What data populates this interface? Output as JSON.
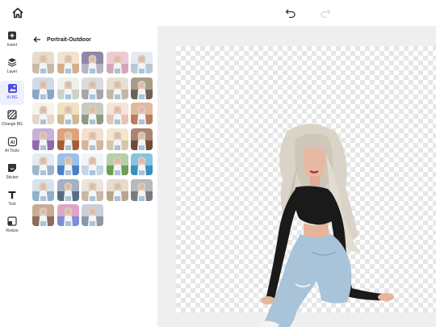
{
  "topbar": {
    "home_icon": "home-icon",
    "undo_icon": "undo-icon",
    "redo_icon": "redo-icon"
  },
  "toolbar": {
    "items": [
      {
        "label": "Insert",
        "icon": "insert-icon"
      },
      {
        "label": "Layer",
        "icon": "layers-icon"
      },
      {
        "label": "AI BG",
        "icon": "ai-bg-icon",
        "active": true
      },
      {
        "label": "Change BG",
        "icon": "change-bg-icon"
      },
      {
        "label": "AI Tools",
        "icon": "ai-tools-icon"
      },
      {
        "label": "Sticker",
        "icon": "sticker-icon"
      },
      {
        "label": "Text",
        "icon": "text-icon"
      },
      {
        "label": "Resize",
        "icon": "resize-icon"
      }
    ]
  },
  "panel": {
    "title": "Portrait-Outdoor",
    "thumbnail_count": 33
  },
  "colors": {
    "accent": "#4a4de8"
  }
}
